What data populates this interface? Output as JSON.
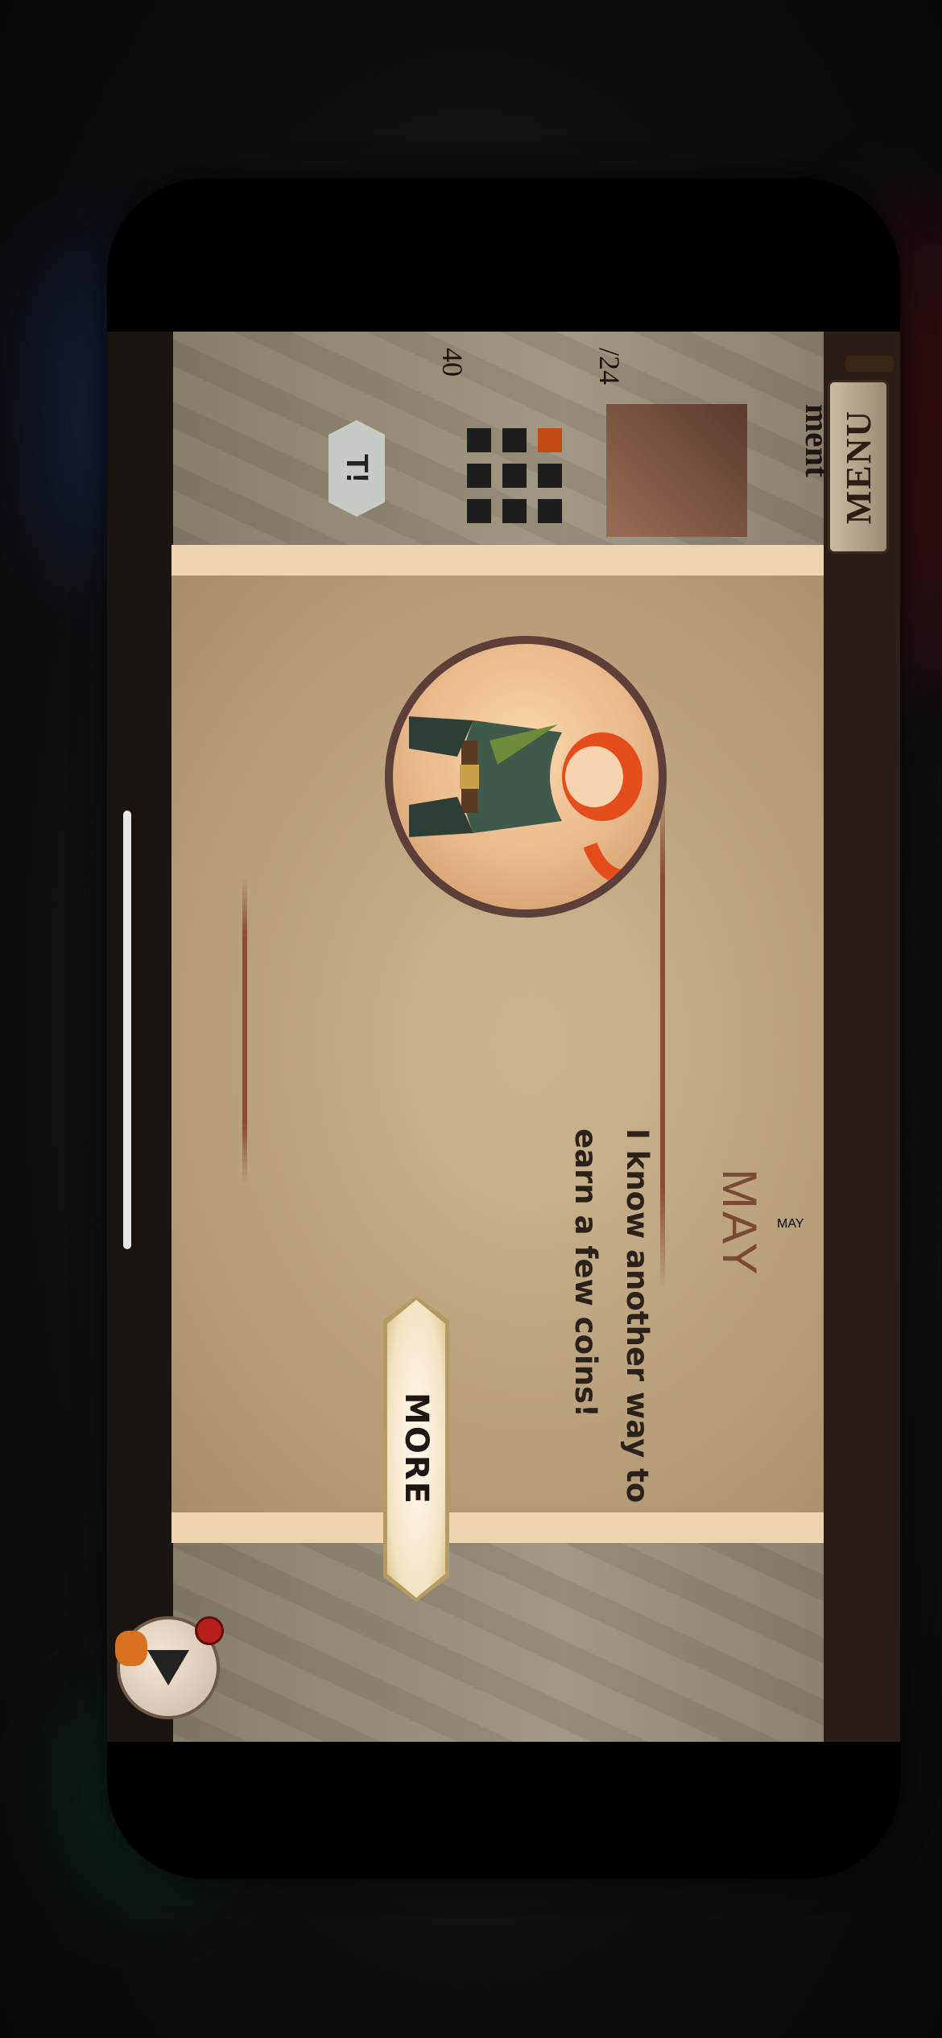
{
  "game": {
    "menu_tab": "MENU",
    "dialog": {
      "speaker": "MAY",
      "message": "I know another way to earn a few coins!",
      "button_label": "MORE"
    },
    "peek": {
      "achievement_label": "ment",
      "progress_text": "/24",
      "count_text": "40",
      "left_button_text": "T!"
    }
  },
  "colors": {
    "title": "#7b4a35",
    "parchment": "#bba27c",
    "parchment_edge": "#f0d3b0"
  }
}
